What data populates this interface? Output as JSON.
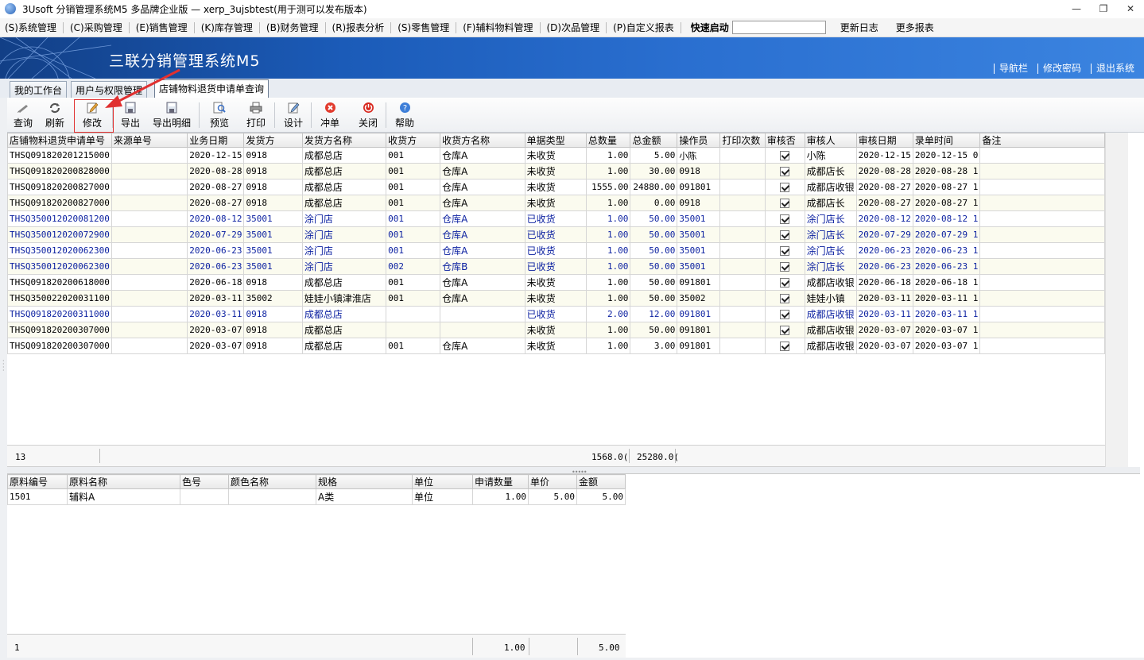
{
  "window": {
    "title": "3Usoft 分销管理系统M5 多品牌企业版 — xerp_3ujsbtest(用于测可以发布版本)",
    "controls": [
      "—",
      "❐",
      "✕"
    ]
  },
  "menu": {
    "items": [
      "(S)系统管理",
      "(C)采购管理",
      "(E)销售管理",
      "(K)库存管理",
      "(B)财务管理",
      "(R)报表分析",
      "(S)零售管理",
      "(F)辅料物料管理",
      "(D)次品管理",
      "(P)自定义报表"
    ],
    "quick_start_label": "快速启动",
    "quick_start_value": "",
    "extra": [
      "更新日志",
      "更多报表"
    ]
  },
  "banner": {
    "brand": "三联分销管理系统M5",
    "links": [
      "导航栏",
      "修改密码",
      "退出系统"
    ]
  },
  "tabs": [
    {
      "label": "我的工作台"
    },
    {
      "label": "用户与权限管理"
    },
    {
      "label": "店铺物料退货申请单查询"
    }
  ],
  "toolbar": {
    "buttons": [
      {
        "label": "查询",
        "icon": "search-icon"
      },
      {
        "label": "刷新",
        "icon": "refresh-icon"
      },
      {
        "label": "修改",
        "icon": "edit-icon"
      },
      {
        "label": "导出",
        "icon": "export-icon"
      },
      {
        "label": "导出明细",
        "icon": "export-detail-icon"
      },
      {
        "label": "预览",
        "icon": "preview-icon"
      },
      {
        "label": "打印",
        "icon": "print-icon"
      },
      {
        "label": "设计",
        "icon": "design-icon"
      },
      {
        "label": "冲单",
        "icon": "reverse-icon"
      },
      {
        "label": "关闭",
        "icon": "close-icon"
      },
      {
        "label": "帮助",
        "icon": "help-icon"
      }
    ]
  },
  "main_grid": {
    "columns": [
      "店铺物料退货申请单号",
      "来源单号",
      "业务日期",
      "发货方",
      "发货方名称",
      "收货方",
      "收货方名称",
      "单据类型",
      "总数量",
      "总金额",
      "操作员",
      "打印次数",
      "审核否",
      "审核人",
      "审核日期",
      "录单时间",
      "备注"
    ],
    "rows": [
      {
        "blue": false,
        "cells": [
          "THSQ091820201215000",
          "",
          "2020-12-15",
          "0918",
          "成都总店",
          "001",
          "仓库A",
          "未收货",
          "1.00",
          "5.00",
          "小陈",
          "",
          "checked",
          "小陈",
          "2020-12-15",
          "2020-12-15 0",
          ""
        ]
      },
      {
        "blue": false,
        "cells": [
          "THSQ091820200828000",
          "",
          "2020-08-28",
          "0918",
          "成都总店",
          "001",
          "仓库A",
          "未收货",
          "1.00",
          "30.00",
          "0918",
          "",
          "checked",
          "成都店长",
          "2020-08-28",
          "2020-08-28 1",
          ""
        ]
      },
      {
        "blue": false,
        "cells": [
          "THSQ091820200827000",
          "",
          "2020-08-27",
          "0918",
          "成都总店",
          "001",
          "仓库A",
          "未收货",
          "1555.00",
          "24880.00",
          "091801",
          "",
          "checked",
          "成都店收银",
          "2020-08-27",
          "2020-08-27 1",
          ""
        ]
      },
      {
        "blue": false,
        "cells": [
          "THSQ091820200827000",
          "",
          "2020-08-27",
          "0918",
          "成都总店",
          "001",
          "仓库A",
          "未收货",
          "1.00",
          "0.00",
          "0918",
          "",
          "checked",
          "成都店长",
          "2020-08-27",
          "2020-08-27 1",
          ""
        ]
      },
      {
        "blue": true,
        "cells": [
          "THSQ350012020081200",
          "",
          "2020-08-12",
          "35001",
          "涂门店",
          "001",
          "仓库A",
          "已收货",
          "1.00",
          "50.00",
          "35001",
          "",
          "checked",
          "涂门店长",
          "2020-08-12",
          "2020-08-12 1",
          ""
        ]
      },
      {
        "blue": true,
        "cells": [
          "THSQ350012020072900",
          "",
          "2020-07-29",
          "35001",
          "涂门店",
          "001",
          "仓库A",
          "已收货",
          "1.00",
          "50.00",
          "35001",
          "",
          "checked",
          "涂门店长",
          "2020-07-29",
          "2020-07-29 1",
          ""
        ]
      },
      {
        "blue": true,
        "cells": [
          "THSQ350012020062300",
          "",
          "2020-06-23",
          "35001",
          "涂门店",
          "001",
          "仓库A",
          "已收货",
          "1.00",
          "50.00",
          "35001",
          "",
          "checked",
          "涂门店长",
          "2020-06-23",
          "2020-06-23 1",
          ""
        ]
      },
      {
        "blue": true,
        "cells": [
          "THSQ350012020062300",
          "",
          "2020-06-23",
          "35001",
          "涂门店",
          "002",
          "仓库B",
          "已收货",
          "1.00",
          "50.00",
          "35001",
          "",
          "checked",
          "涂门店长",
          "2020-06-23",
          "2020-06-23 1",
          ""
        ]
      },
      {
        "blue": false,
        "cells": [
          "THSQ091820200618000",
          "",
          "2020-06-18",
          "0918",
          "成都总店",
          "001",
          "仓库A",
          "未收货",
          "1.00",
          "50.00",
          "091801",
          "",
          "checked",
          "成都店收银",
          "2020-06-18",
          "2020-06-18 1",
          ""
        ]
      },
      {
        "blue": false,
        "cells": [
          "THSQ350022020031100",
          "",
          "2020-03-11",
          "35002",
          "娃娃小镇津淮店",
          "001",
          "仓库A",
          "未收货",
          "1.00",
          "50.00",
          "35002",
          "",
          "checked",
          "娃娃小镇",
          "2020-03-11",
          "2020-03-11 1",
          ""
        ]
      },
      {
        "blue": true,
        "cells": [
          "THSQ091820200311000",
          "",
          "2020-03-11",
          "0918",
          "成都总店",
          "",
          "",
          "已收货",
          "2.00",
          "12.00",
          "091801",
          "",
          "checked",
          "成都店收银",
          "2020-03-11",
          "2020-03-11 1",
          ""
        ]
      },
      {
        "blue": false,
        "cells": [
          "THSQ091820200307000",
          "",
          "2020-03-07",
          "0918",
          "成都总店",
          "",
          "",
          "未收货",
          "1.00",
          "50.00",
          "091801",
          "",
          "checked",
          "成都店收银",
          "2020-03-07",
          "2020-03-07 1",
          ""
        ]
      },
      {
        "blue": false,
        "cells": [
          "THSQ091820200307000",
          "",
          "2020-03-07",
          "0918",
          "成都总店",
          "001",
          "仓库A",
          "未收货",
          "1.00",
          "3.00",
          "091801",
          "",
          "checked",
          "成都店收银",
          "2020-03-07",
          "2020-03-07 1",
          ""
        ]
      }
    ],
    "summary": {
      "count": "13",
      "total_qty": "1568.0(",
      "total_amount": "25280.0("
    }
  },
  "detail_grid": {
    "columns": [
      "原料编号",
      "原料名称",
      "色号",
      "颜色名称",
      "规格",
      "单位",
      "申请数量",
      "单价",
      "金额"
    ],
    "rows": [
      {
        "cells": [
          "1501",
          "辅料A",
          "",
          "",
          "A类",
          "单位",
          "1.00",
          "5.00",
          "5.00"
        ]
      }
    ],
    "summary": {
      "count": "1",
      "total_qty": "1.00",
      "total_amount": "5.00"
    }
  },
  "colors": {
    "banner": "#1b5bb8",
    "blue_row_text": "#0a1fa0",
    "highlight": "#e03030"
  }
}
